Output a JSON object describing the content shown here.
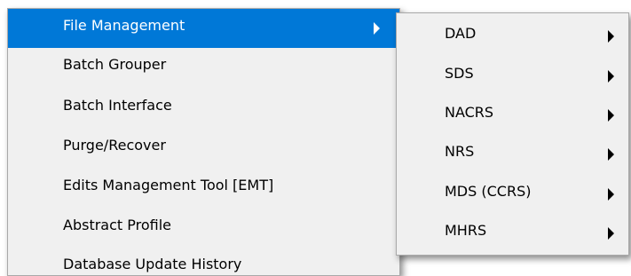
{
  "main_menu": {
    "items": [
      {
        "label": "File Management",
        "highlighted": true,
        "has_submenu": true
      },
      {
        "label": "Batch Grouper"
      },
      {
        "label": "Batch Interface"
      },
      {
        "label": "Purge/Recover"
      },
      {
        "label": "Edits Management Tool [EMT]"
      },
      {
        "label": "Abstract Profile"
      },
      {
        "label": "Database Update History"
      }
    ]
  },
  "sub_menu": {
    "items": [
      {
        "label": "DAD"
      },
      {
        "label": "SDS"
      },
      {
        "label": "NACRS"
      },
      {
        "label": "NRS"
      },
      {
        "label": "MDS (CCRS)"
      },
      {
        "label": "MHRS"
      }
    ]
  },
  "colors": {
    "highlight": "#0078d7",
    "menu_background": "#f0f0f0"
  }
}
